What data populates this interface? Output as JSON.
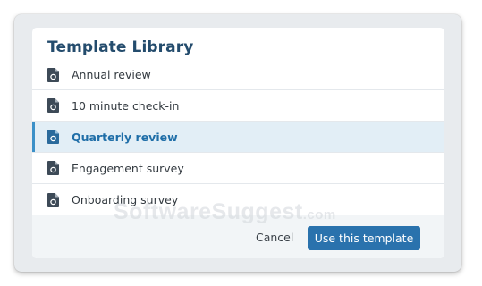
{
  "dialog": {
    "title": "Template Library"
  },
  "templates": [
    {
      "label": "Annual review",
      "icon": "document-refresh-icon",
      "selected": false
    },
    {
      "label": "10 minute check-in",
      "icon": "document-refresh-icon",
      "selected": false
    },
    {
      "label": "Quarterly review",
      "icon": "document-refresh-icon",
      "selected": true
    },
    {
      "label": "Engagement survey",
      "icon": "document-refresh-icon",
      "selected": false
    },
    {
      "label": "Onboarding survey",
      "icon": "document-refresh-icon",
      "selected": false
    }
  ],
  "footer": {
    "cancel_label": "Cancel",
    "use_label": "Use this template"
  },
  "watermark": {
    "name": "SoftwareSuggest",
    "suffix": ".com"
  },
  "colors": {
    "title": "#244c6d",
    "primary_button": "#2a72ad",
    "selected_bg": "#e2eef6",
    "selected_accent": "#3b90c8",
    "selected_text": "#1f6ea8",
    "icon": "#3d4a57"
  }
}
